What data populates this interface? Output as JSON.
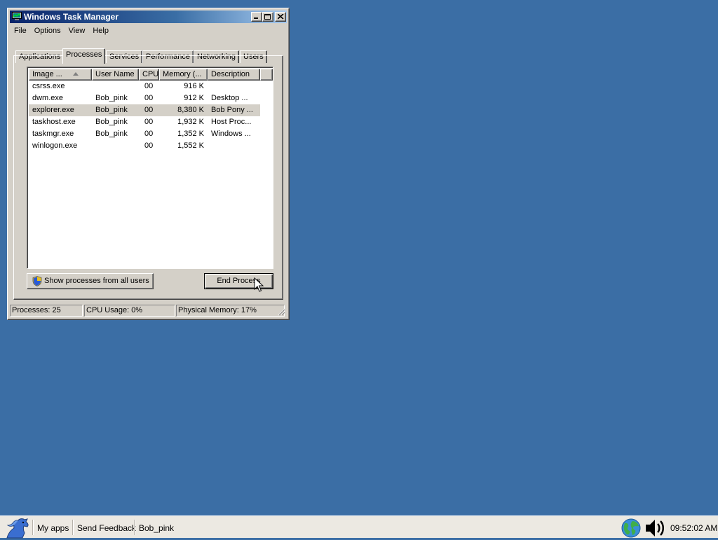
{
  "window": {
    "title": "Windows Task Manager",
    "menu": [
      "File",
      "Options",
      "View",
      "Help"
    ],
    "tabs": [
      "Applications",
      "Processes",
      "Services",
      "Performance",
      "Networking",
      "Users"
    ],
    "active_tab": "Processes",
    "columns": [
      "Image ...",
      "User Name",
      "CPU",
      "Memory (...",
      "Description"
    ],
    "rows": [
      {
        "image": "csrss.exe",
        "user": "",
        "cpu": "00",
        "memory": "916 K",
        "description": ""
      },
      {
        "image": "dwm.exe",
        "user": "Bob_pink",
        "cpu": "00",
        "memory": "912 K",
        "description": "Desktop ..."
      },
      {
        "image": "explorer.exe",
        "user": "Bob_pink",
        "cpu": "00",
        "memory": "8,380 K",
        "description": "Bob Pony ..."
      },
      {
        "image": "taskhost.exe",
        "user": "Bob_pink",
        "cpu": "00",
        "memory": "1,932 K",
        "description": "Host Proc..."
      },
      {
        "image": "taskmgr.exe",
        "user": "Bob_pink",
        "cpu": "00",
        "memory": "1,352 K",
        "description": "Windows ..."
      },
      {
        "image": "winlogon.exe",
        "user": "",
        "cpu": "00",
        "memory": "1,552 K",
        "description": ""
      }
    ],
    "selected_row": "explorer.exe",
    "show_all_label": "Show processes from all users",
    "end_process_label": "End Process",
    "status": {
      "processes": "Processes: 25",
      "cpu": "CPU Usage: 0%",
      "memory": "Physical Memory: 17%"
    }
  },
  "taskbar": {
    "items": [
      "My apps",
      "Send Feedback",
      "Bob_pink"
    ],
    "clock": "09:52:02 AM"
  },
  "colors": {
    "desktop": "#3b6ea5",
    "window_face": "#d4d0c8",
    "title_gradient_start": "#0a246a",
    "taskbar": "#ece9e2"
  }
}
